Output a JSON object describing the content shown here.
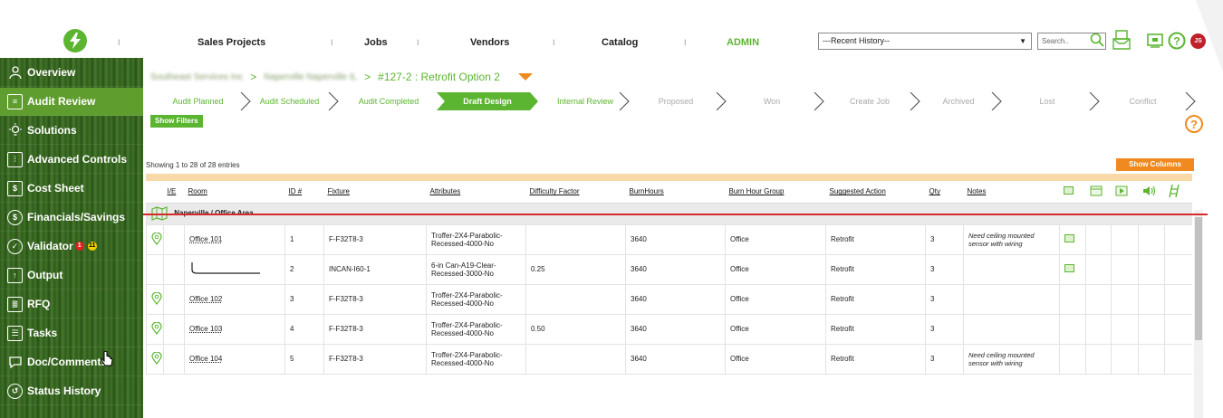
{
  "nav": {
    "items": [
      "Sales Projects",
      "Jobs",
      "Vendors",
      "Catalog",
      "ADMIN"
    ],
    "history_select": "---Recent History--",
    "search_placeholder": "Search.."
  },
  "user": {
    "initials": "JS"
  },
  "sidebar": {
    "items": [
      {
        "label": "Overview",
        "icon": "people-icon"
      },
      {
        "label": "Audit Review",
        "icon": "clipboard-icon"
      },
      {
        "label": "Solutions",
        "icon": "lightbulb-icon"
      },
      {
        "label": "Advanced Controls",
        "icon": "sliders-icon"
      },
      {
        "label": "Cost Sheet",
        "icon": "cost-sheet-icon"
      },
      {
        "label": "Financials/Savings",
        "icon": "dollar-icon"
      },
      {
        "label": "Validator",
        "icon": "check-circle-icon",
        "badge_red": "1",
        "badge_yellow": "11"
      },
      {
        "label": "Output",
        "icon": "output-icon"
      },
      {
        "label": "RFQ",
        "icon": "rfq-icon"
      },
      {
        "label": "Tasks",
        "icon": "tasks-icon"
      },
      {
        "label": "Doc/Comments",
        "icon": "comment-icon"
      },
      {
        "label": "Status History",
        "icon": "history-icon"
      }
    ]
  },
  "breadcrumb": {
    "level1": "Southeast Services Inc",
    "level2": "Naperville Naperville IL",
    "current": "#127-2 : Retrofit Option 2"
  },
  "pipeline": {
    "stages": [
      "Audit Planned",
      "Audit Scheduled",
      "Audit Completed",
      "Draft Design",
      "Internal Review",
      "Proposed",
      "Won",
      "Create Job",
      "Archived",
      "Lost",
      "Conflict"
    ],
    "active": "Draft Design"
  },
  "filters_button": "Show Filters",
  "columns_button": "Show Columns",
  "entries_text": "Showing 1 to 28 of 28 entries",
  "table": {
    "headers": [
      "I/E",
      "Room",
      "ID #",
      "Fixture",
      "Attributes",
      "Difficulty Factor",
      "BurnHours",
      "Burn Hour Group",
      "Suggested Action",
      "Qty",
      "Notes"
    ],
    "group": "Naperville / Office Area",
    "rows": [
      {
        "room": "Office 101",
        "id": "1",
        "fixture": "F-F32T8-3",
        "attributes": "Troffer-2X4-Parabolic-Recessed-4000-No",
        "difficulty": "",
        "burn": "3640",
        "group": "Office",
        "action": "Retrofit",
        "qty": "3",
        "notes": "Need ceiling mounted sensor with wiring",
        "pin": true,
        "cam": true
      },
      {
        "room": "",
        "id": "2",
        "fixture": "INCAN-I60-1",
        "attributes": "6-in Can-A19-Clear-Recessed-3000-No",
        "difficulty": "0.25",
        "burn": "3640",
        "group": "Office",
        "action": "Retrofit",
        "qty": "3",
        "notes": "",
        "pin": false,
        "cam": true
      },
      {
        "room": "Office 102",
        "id": "3",
        "fixture": "F-F32T8-3",
        "attributes": "Troffer-2X4-Parabolic-Recessed-4000-No",
        "difficulty": "",
        "burn": "3640",
        "group": "Office",
        "action": "Retrofit",
        "qty": "3",
        "notes": "",
        "pin": true,
        "cam": false
      },
      {
        "room": "Office 103",
        "id": "4",
        "fixture": "F-F32T8-3",
        "attributes": "Troffer-2X4-Parabolic-Recessed-4000-No",
        "difficulty": "0.50",
        "burn": "3640",
        "group": "Office",
        "action": "Retrofit",
        "qty": "3",
        "notes": "",
        "pin": true,
        "cam": false
      },
      {
        "room": "Office 104",
        "id": "5",
        "fixture": "F-F32T8-3",
        "attributes": "Troffer-2X4-Parabolic-Recessed-4000-No",
        "difficulty": "",
        "burn": "3640",
        "group": "Office",
        "action": "Retrofit",
        "qty": "3",
        "notes": "Need ceiling mounted sensor with wiring",
        "pin": true,
        "cam": false
      }
    ]
  },
  "colors": {
    "brand_green": "#5cb531",
    "accent_orange": "#f08a20",
    "alert_red": "#d62a2a"
  }
}
